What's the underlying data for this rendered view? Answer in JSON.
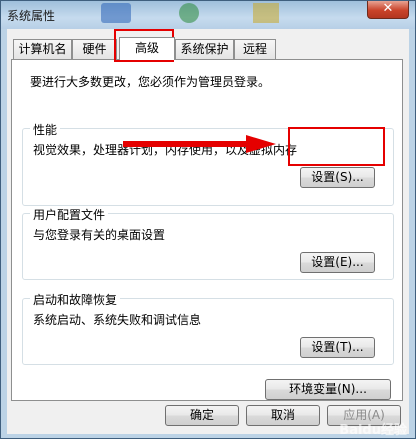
{
  "window": {
    "title": "系统属性",
    "close_glyph": "✕"
  },
  "tabs": [
    {
      "label": "计算机名"
    },
    {
      "label": "硬件"
    },
    {
      "label": "高级"
    },
    {
      "label": "系统保护"
    },
    {
      "label": "远程"
    }
  ],
  "active_tab": "高级",
  "note": "要进行大多数更改，您必须作为管理员登录。",
  "performance": {
    "legend": "性能",
    "description": "视觉效果，处理器计划，内存使用，以及虚拟内存",
    "button": "设置(S)..."
  },
  "user_profiles": {
    "legend": "用户配置文件",
    "description": "与您登录有关的桌面设置",
    "button": "设置(E)..."
  },
  "startup_recovery": {
    "legend": "启动和故障恢复",
    "description": "系统启动、系统失败和调试信息",
    "button": "设置(T)..."
  },
  "env_button": "环境变量(N)...",
  "footer": {
    "ok": "确定",
    "cancel": "取消",
    "apply": "应用(A)"
  },
  "watermark": "Baidu经验",
  "annotation_color": "#e50000"
}
